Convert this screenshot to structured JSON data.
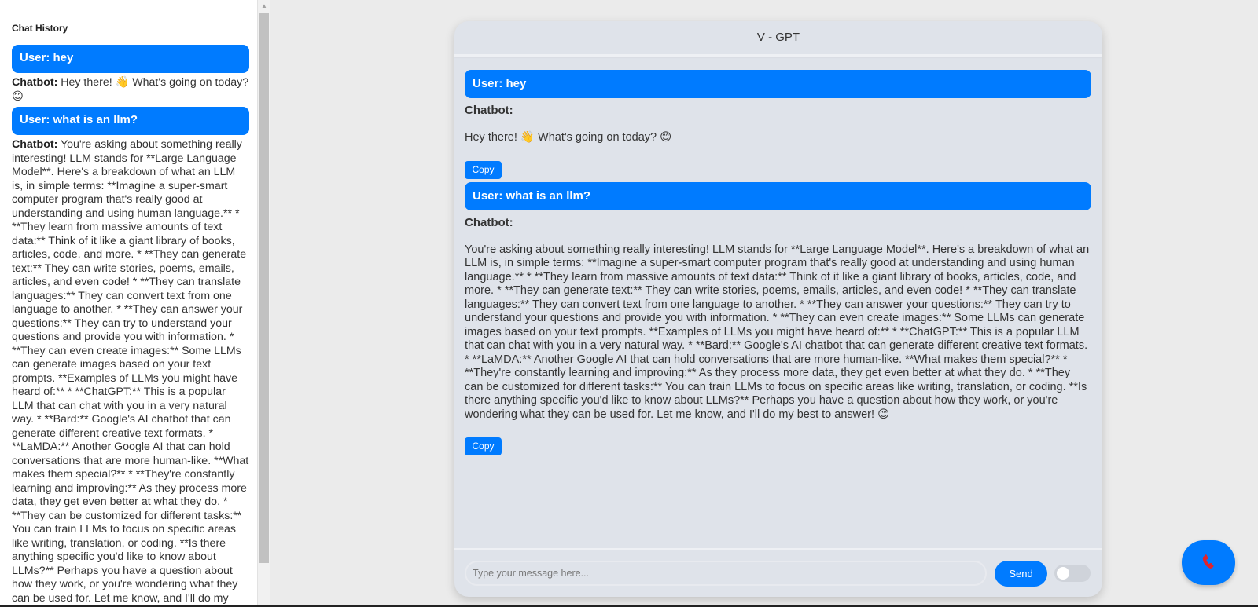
{
  "sidebar": {
    "title": "Chat History",
    "items": [
      {
        "user": "User: hey",
        "bot_label": "Chatbot:",
        "bot_text": " Hey there! 👋 What's going on today? 😊"
      },
      {
        "user": "User: what is an llm?",
        "bot_label": "Chatbot:",
        "bot_text": " You're asking about something really interesting! LLM stands for **Large Language Model**. Here's a breakdown of what an LLM is, in simple terms: **Imagine a super-smart computer program that's really good at understanding and using human language.** * **They learn from massive amounts of text data:** Think of it like a giant library of books, articles, code, and more. * **They can generate text:** They can write stories, poems, emails, articles, and even code! * **They can translate languages:** They can convert text from one language to another. * **They can answer your questions:** They can try to understand your questions and provide you with information. * **They can even create images:** Some LLMs can generate images based on your text prompts. **Examples of LLMs you might have heard of:** * **ChatGPT:** This is a popular LLM that can chat with you in a very natural way. * **Bard:** Google's AI chatbot that can generate different creative text formats. * **LaMDA:** Another Google AI that can hold conversations that are more human-like. **What makes them special?** * **They're constantly learning and improving:** As they process more data, they get even better at what they do. * **They can be customized for different tasks:** You can train LLMs to focus on specific areas like writing, translation, or coding. **Is there anything specific you'd like to know about LLMs?** Perhaps you have a question about how they work, or you're wondering what they can be used for. Let me know, and I'll do my best to answer! 😊"
      }
    ]
  },
  "chat": {
    "title": "V - GPT",
    "messages": [
      {
        "user": "User: hey",
        "bot_label": "Chatbot:",
        "bot_text": "Hey there! 👋 What's going on today? 😊",
        "copy_label": "Copy"
      },
      {
        "user": "User: what is an llm?",
        "bot_label": "Chatbot:",
        "bot_text": "You're asking about something really interesting! LLM stands for **Large Language Model**. Here's a breakdown of what an LLM is, in simple terms: **Imagine a super-smart computer program that's really good at understanding and using human language.** * **They learn from massive amounts of text data:** Think of it like a giant library of books, articles, code, and more. * **They can generate text:** They can write stories, poems, emails, articles, and even code! * **They can translate languages:** They can convert text from one language to another. * **They can answer your questions:** They can try to understand your questions and provide you with information. * **They can even create images:** Some LLMs can generate images based on your text prompts. **Examples of LLMs you might have heard of:** * **ChatGPT:** This is a popular LLM that can chat with you in a very natural way. * **Bard:** Google's AI chatbot that can generate different creative text formats. * **LaMDA:** Another Google AI that can hold conversations that are more human-like. **What makes them special?** * **They're constantly learning and improving:** As they process more data, they get even better at what they do. * **They can be customized for different tasks:** You can train LLMs to focus on specific areas like writing, translation, or coding. **Is there anything specific you'd like to know about LLMs?** Perhaps you have a question about how they work, or you're wondering what they can be used for. Let me know, and I'll do my best to answer! 😊",
        "copy_label": "Copy"
      }
    ],
    "input_placeholder": "Type your message here...",
    "input_value": "",
    "send_label": "Send",
    "toggle_on": false
  },
  "colors": {
    "accent": "#007bff",
    "chat_background": "#dfe3ea",
    "page_background": "#ebebeb"
  },
  "icons": {
    "call_button": "phone-icon"
  }
}
